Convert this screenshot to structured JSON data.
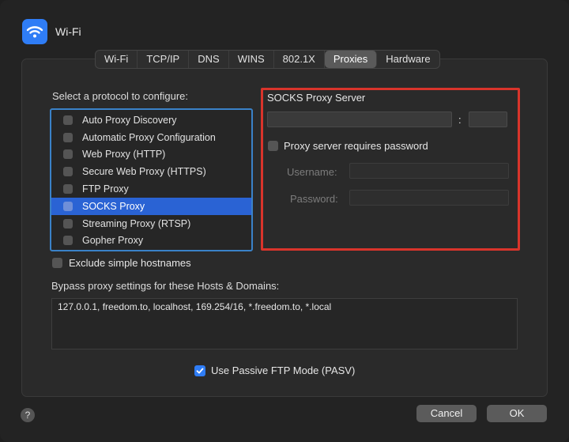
{
  "window": {
    "title": "Wi-Fi",
    "icon": "wifi-icon"
  },
  "tabs": [
    {
      "label": "Wi-Fi",
      "active": false
    },
    {
      "label": "TCP/IP",
      "active": false
    },
    {
      "label": "DNS",
      "active": false
    },
    {
      "label": "WINS",
      "active": false
    },
    {
      "label": "802.1X",
      "active": false
    },
    {
      "label": "Proxies",
      "active": true
    },
    {
      "label": "Hardware",
      "active": false
    }
  ],
  "protocols": {
    "label": "Select a protocol to configure:",
    "items": [
      {
        "label": "Auto Proxy Discovery",
        "checked": false,
        "selected": false
      },
      {
        "label": "Automatic Proxy Configuration",
        "checked": false,
        "selected": false
      },
      {
        "label": "Web Proxy (HTTP)",
        "checked": false,
        "selected": false
      },
      {
        "label": "Secure Web Proxy (HTTPS)",
        "checked": false,
        "selected": false
      },
      {
        "label": "FTP Proxy",
        "checked": false,
        "selected": false
      },
      {
        "label": "SOCKS Proxy",
        "checked": false,
        "selected": true
      },
      {
        "label": "Streaming Proxy (RTSP)",
        "checked": false,
        "selected": false
      },
      {
        "label": "Gopher Proxy",
        "checked": false,
        "selected": false
      }
    ]
  },
  "socks": {
    "title": "SOCKS Proxy Server",
    "server": "",
    "colon": ":",
    "port": "",
    "requires_password_label": "Proxy server requires password",
    "requires_password": false,
    "username_label": "Username:",
    "username": "",
    "password_label": "Password:",
    "password": ""
  },
  "exclude_simple_label": "Exclude simple hostnames",
  "bypass": {
    "label": "Bypass proxy settings for these Hosts & Domains:",
    "value": "127.0.0.1, freedom.to, localhost, 169.254/16, *.freedom.to, *.local"
  },
  "pasv_label": "Use Passive FTP Mode (PASV)",
  "pasv_checked": true,
  "help_label": "?",
  "buttons": {
    "cancel": "Cancel",
    "ok": "OK"
  },
  "colors": {
    "accent": "#2f7df6",
    "selection": "#2a63d4",
    "highlight_red": "#d9342b",
    "list_border": "#3a82c8"
  }
}
